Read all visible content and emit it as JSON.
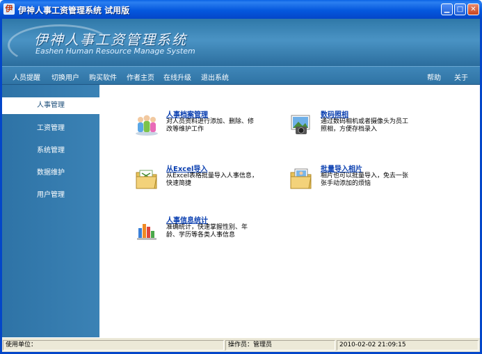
{
  "window": {
    "title": "伊神人事工资管理系统  试用版",
    "icon": "app-logo-icon"
  },
  "banner": {
    "title_cn": "伊神人事工资管理系统",
    "title_en": "Eashen Human Resource Manage System"
  },
  "menu": {
    "left": [
      "人员提醒",
      "切换用户",
      "购买软件",
      "作者主页",
      "在线升级",
      "退出系统"
    ],
    "right": [
      "帮助",
      "关于"
    ]
  },
  "sidebar": {
    "items": [
      "人事管理",
      "工资管理",
      "系统管理",
      "数据维护",
      "用户管理"
    ],
    "active": 0
  },
  "features": [
    {
      "title": "人事档案管理",
      "desc": "对人员资料进行添加、删除、修改等维护工作",
      "icon": "people-icon"
    },
    {
      "title": "数码照相",
      "desc": "通过数码相机或者摄像头为员工照相，方便存档录入",
      "icon": "camera-icon"
    },
    {
      "title": "从Excel导入",
      "desc": "从Excel表格批量导入人事信息，快速简捷",
      "icon": "folder-import-icon"
    },
    {
      "title": "批量导入相片",
      "desc": "相片也可以批量导入，免去一张张手动添加的烦恼",
      "icon": "photo-import-icon"
    },
    {
      "title": "人事信息统计",
      "desc": "准确统计，快速掌握性别、年龄、学历等各类人事信息",
      "icon": "bar-chart-icon"
    }
  ],
  "status": {
    "unit_label": "使用单位：",
    "operator_label": "操作员：管理员",
    "datetime": "2010-02-02  21:09:15"
  },
  "colors": {
    "title_bar": "#0558de",
    "banner": "#3b84b8",
    "sidebar": "#3379ad",
    "link": "#0a3fb0"
  }
}
